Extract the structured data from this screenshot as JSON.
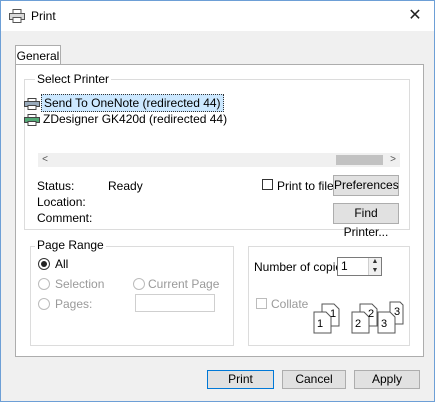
{
  "window": {
    "title": "Print",
    "close_glyph": "✕"
  },
  "tabs": [
    {
      "label": "General"
    }
  ],
  "select_printer": {
    "label": "Select Printer",
    "printers": [
      {
        "name": "Send To OneNote (redirected 44)",
        "selected": true
      },
      {
        "name": "ZDesigner GK420d (redirected 44)",
        "selected": false
      }
    ],
    "scroll_left": "<",
    "scroll_right": ">",
    "status_label": "Status:",
    "status_value": "Ready",
    "location_label": "Location:",
    "comment_label": "Comment:",
    "print_to_file_label": "Print to file",
    "print_to_file_checked": false,
    "preferences_label": "Preferences",
    "find_printer_label": "Find Printer..."
  },
  "page_range": {
    "label": "Page Range",
    "all_label": "All",
    "selection_label": "Selection",
    "current_page_label": "Current Page",
    "pages_label": "Pages:",
    "pages_value": "",
    "selected": "All"
  },
  "copies": {
    "label": "Number of copies:",
    "value": "1",
    "collate_label": "Collate",
    "collate_checked": false,
    "collate_digits": [
      "1",
      "1",
      "2",
      "2",
      "3",
      "3"
    ]
  },
  "footer": {
    "print_label": "Print",
    "cancel_label": "Cancel",
    "apply_label": "Apply"
  },
  "colors": {
    "selection_bg": "#cce8ff",
    "default_button_border": "#0078d7",
    "window_border": "#6d9fd6"
  },
  "icons": [
    "printer-icon",
    "close-icon",
    "chevron-left-icon",
    "chevron-right-icon",
    "spin-up-icon",
    "spin-down-icon",
    "collate-pages-icon"
  ]
}
